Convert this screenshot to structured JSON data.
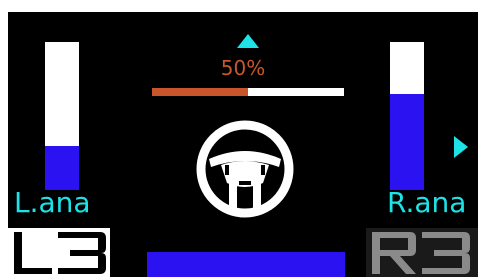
{
  "left_analog": {
    "label": "L.ana",
    "level_percent": 30,
    "fill_color": "#2b12f0",
    "track_color": "#ffffff"
  },
  "right_analog": {
    "label": "R.ana",
    "level_percent": 65,
    "fill_color": "#2b12f0",
    "track_color": "#ffffff"
  },
  "steering": {
    "percent_label": "50%",
    "percent_value": 50,
    "progress_fill_color": "#c8562a",
    "progress_track_color": "#ffffff",
    "text_color": "#c8562a",
    "icon": "steering-wheel-icon"
  },
  "indicators": {
    "up_arrow_icon": "arrow-up-icon",
    "right_arrow_icon": "arrow-right-icon",
    "color": "#1de3e8"
  },
  "buttons": {
    "l3": {
      "label": "L3",
      "active": true
    },
    "r3": {
      "label": "R3",
      "active": false
    }
  },
  "bottom_bar_color": "#2b12f0",
  "label_color": "#1de3e8"
}
